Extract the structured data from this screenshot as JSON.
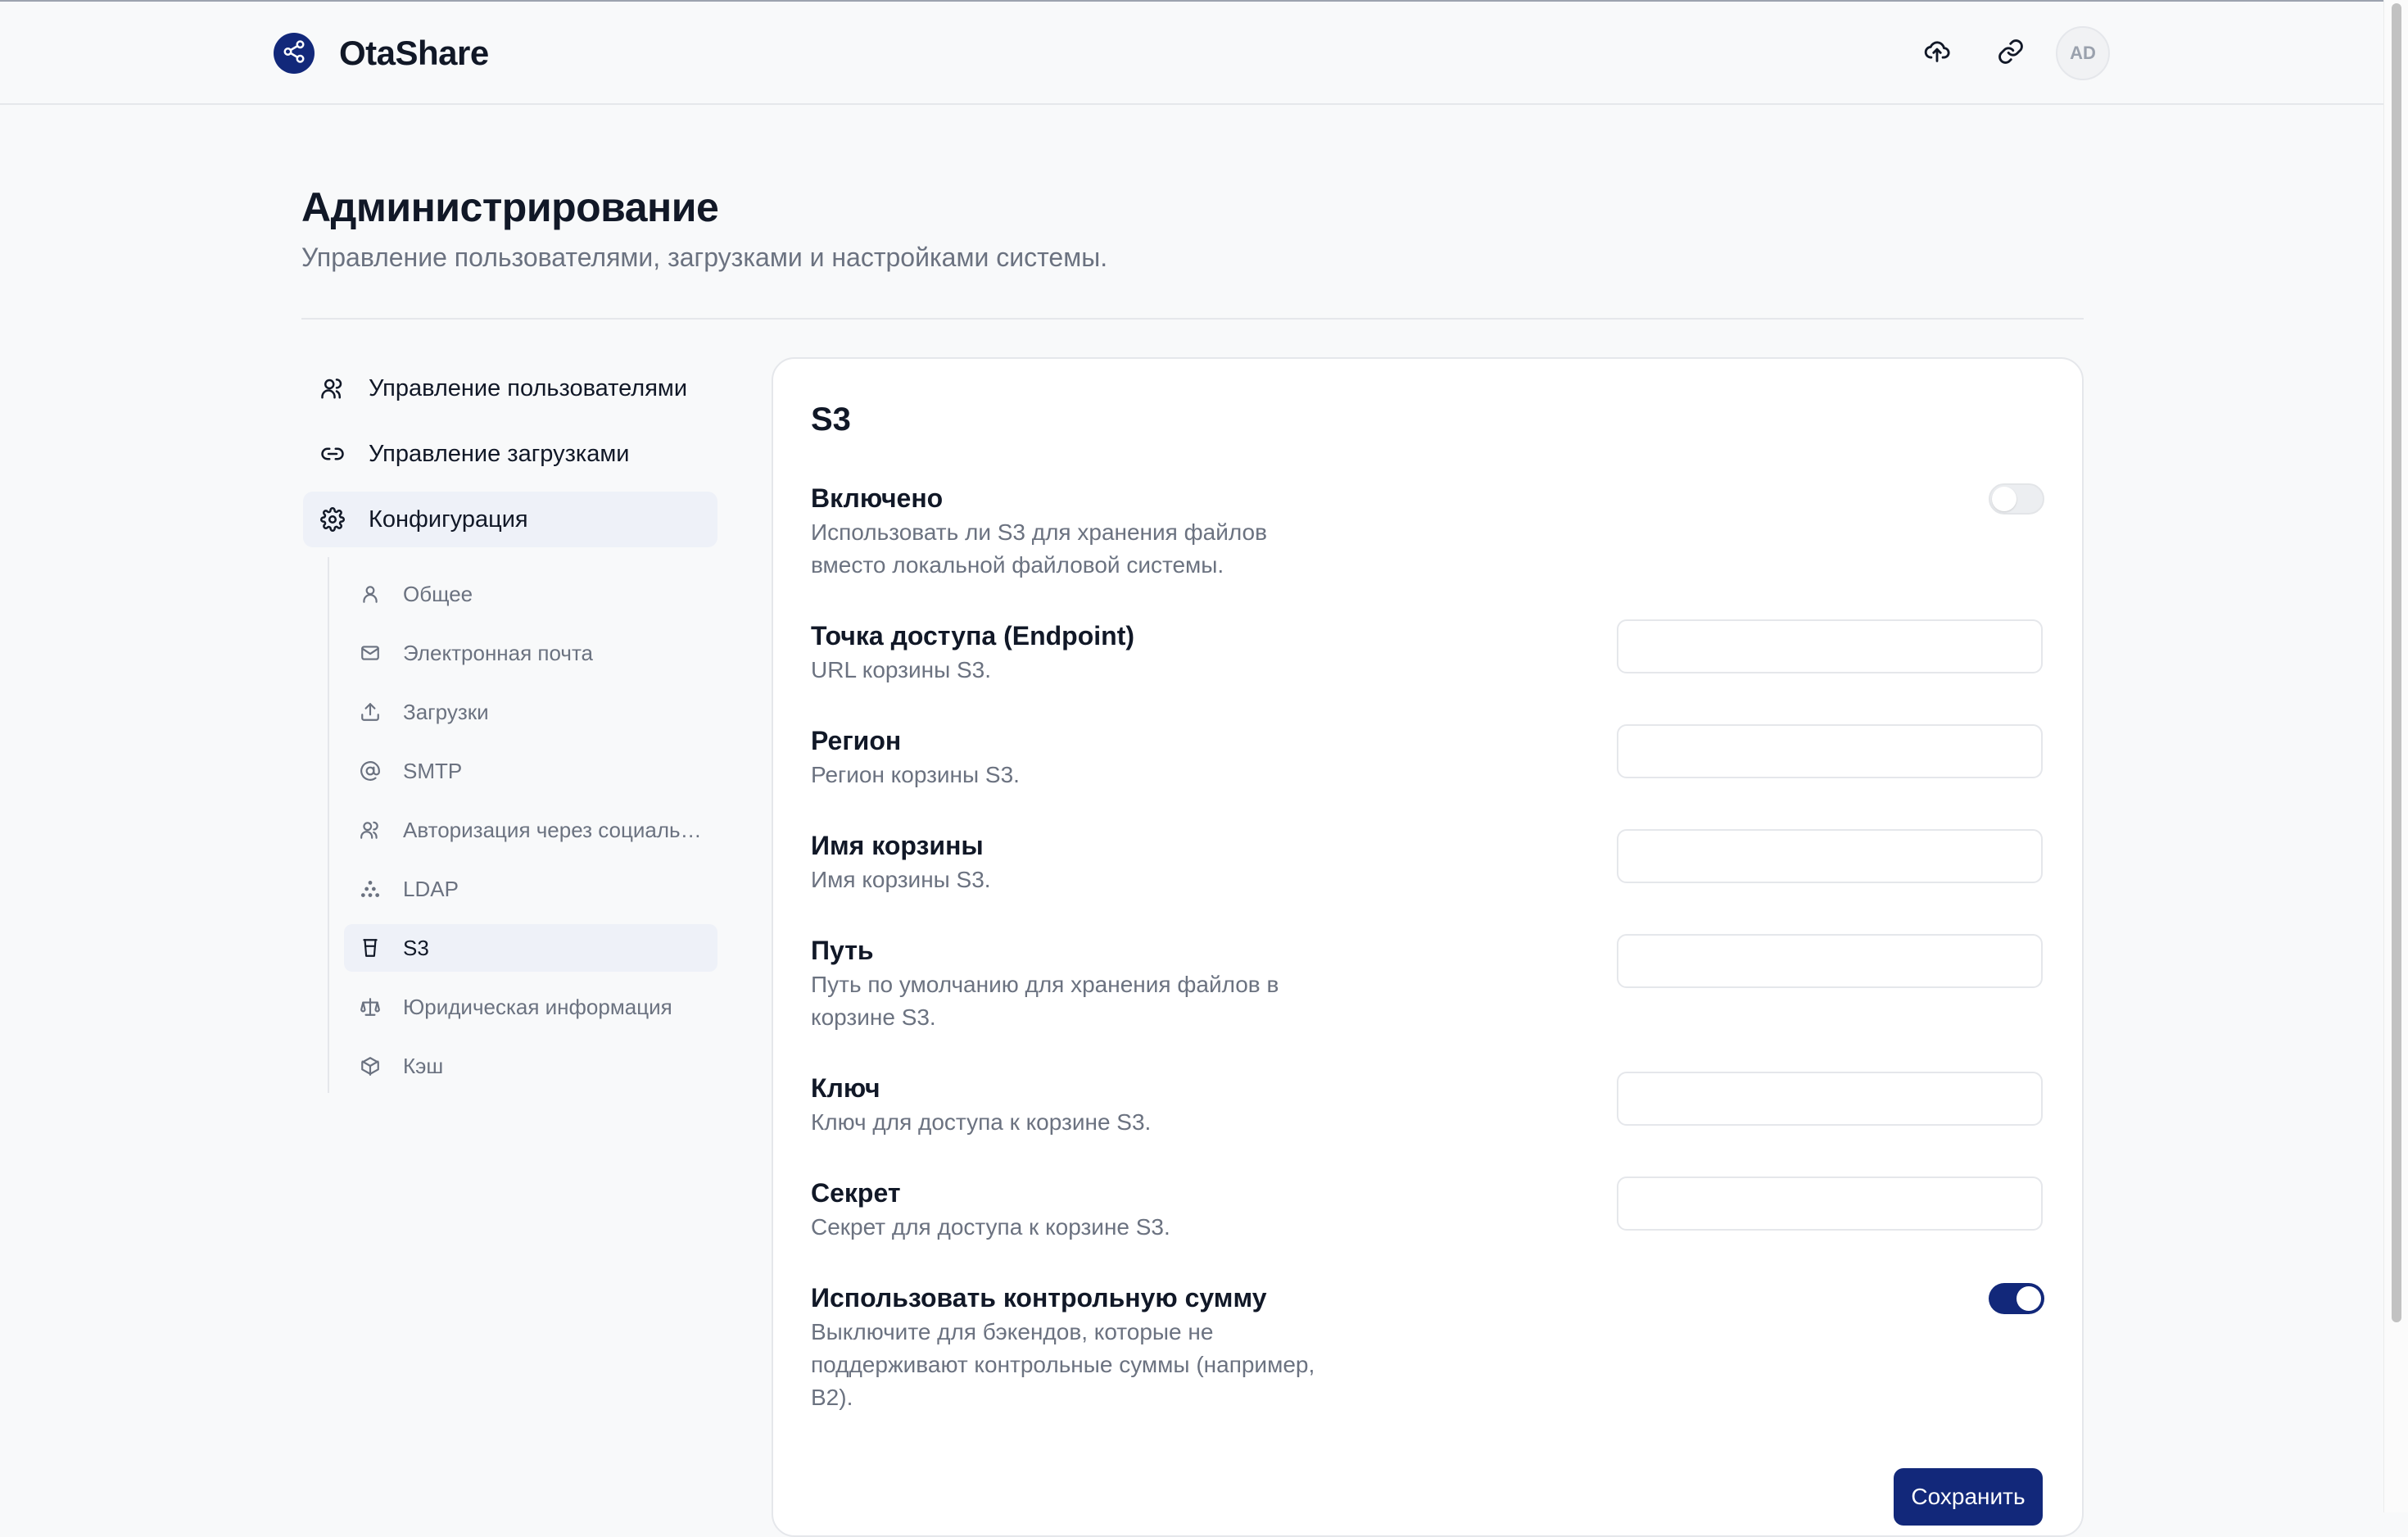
{
  "header": {
    "brand": "OtaShare",
    "avatar_initials": "AD",
    "icons": [
      "share-icon",
      "upload-cloud-icon",
      "link-icon"
    ]
  },
  "page": {
    "title": "Администрирование",
    "subtitle": "Управление пользователями, загрузками и настройками системы."
  },
  "sidebar": {
    "items": [
      {
        "label": "Управление пользователями",
        "icon": "users-icon"
      },
      {
        "label": "Управление загрузками",
        "icon": "link-icon"
      },
      {
        "label": "Конфигурация",
        "icon": "gear-icon",
        "active": true
      }
    ],
    "subitems": [
      {
        "label": "Общее",
        "icon": "user-icon"
      },
      {
        "label": "Электронная почта",
        "icon": "mail-icon"
      },
      {
        "label": "Загрузки",
        "icon": "upload-icon"
      },
      {
        "label": "SMTP",
        "icon": "at-icon"
      },
      {
        "label": "Авторизация через социальные сети",
        "icon": "users-icon"
      },
      {
        "label": "LDAP",
        "icon": "network-icon"
      },
      {
        "label": "S3",
        "icon": "bucket-icon",
        "active": true
      },
      {
        "label": "Юридическая информация",
        "icon": "scale-icon"
      },
      {
        "label": "Кэш",
        "icon": "box-icon"
      }
    ]
  },
  "s3": {
    "title": "S3",
    "enabled": {
      "label": "Включено",
      "desc": "Использовать ли S3 для хранения файлов вместо локальной файловой системы.",
      "value": false
    },
    "endpoint": {
      "label": "Точка доступа (Endpoint)",
      "desc": "URL корзины S3.",
      "value": ""
    },
    "region": {
      "label": "Регион",
      "desc": "Регион корзины S3.",
      "value": ""
    },
    "bucket": {
      "label": "Имя корзины",
      "desc": "Имя корзины S3.",
      "value": ""
    },
    "path": {
      "label": "Путь",
      "desc": "Путь по умолчанию для хранения файлов в корзине S3.",
      "value": ""
    },
    "key": {
      "label": "Ключ",
      "desc": "Ключ для доступа к корзине S3.",
      "value": ""
    },
    "secret": {
      "label": "Секрет",
      "desc": "Секрет для доступа к корзине S3.",
      "value": ""
    },
    "checksum": {
      "label": "Использовать контрольную сумму",
      "desc": "Выключите для бэкендов, которые не поддерживают контрольные суммы (например, B2).",
      "value": true
    },
    "save_label": "Сохранить"
  },
  "colors": {
    "accent": "#12287a",
    "muted": "#6b7280",
    "active_bg": "#eef1f8"
  }
}
